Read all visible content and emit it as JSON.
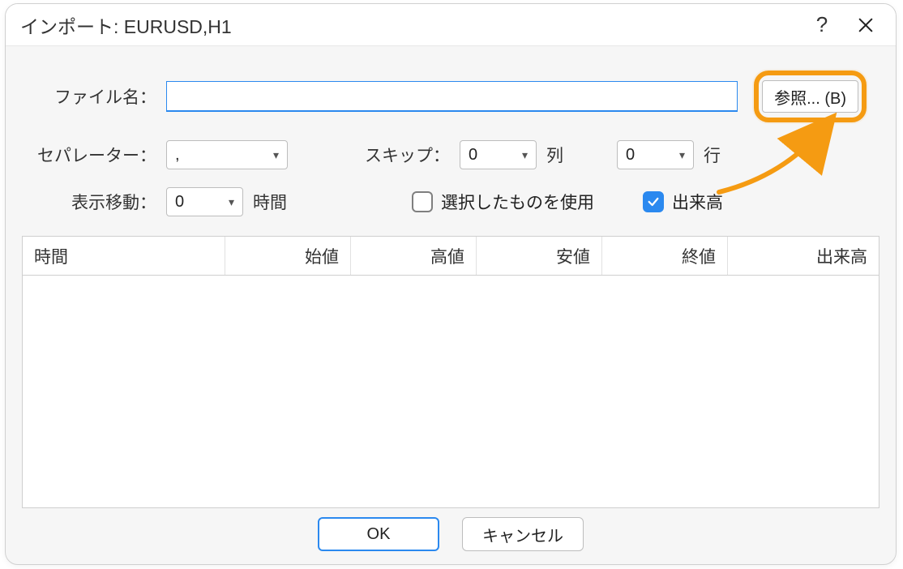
{
  "title": "インポート: EURUSD,H1",
  "labels": {
    "filename": "ファイル名：",
    "separator": "セパレーター：",
    "skip": "スキップ：",
    "columns_unit": "列",
    "rows_unit": "行",
    "shift": "表示移動：",
    "hours_unit": "時間",
    "use_selected": "選択したものを使用",
    "volume": "出来高"
  },
  "values": {
    "filename": "",
    "separator": ",",
    "skip_cols": "0",
    "skip_rows": "0",
    "shift": "0"
  },
  "browse_label": "参照... (B)",
  "checks": {
    "use_selected": false,
    "volume": true
  },
  "table": {
    "headers": [
      "時間",
      "始値",
      "高値",
      "安値",
      "終値",
      "出来高"
    ]
  },
  "buttons": {
    "ok": "OK",
    "cancel": "キャンセル"
  },
  "titlebar": {
    "help_tooltip": "?",
    "close_tooltip": "×"
  }
}
